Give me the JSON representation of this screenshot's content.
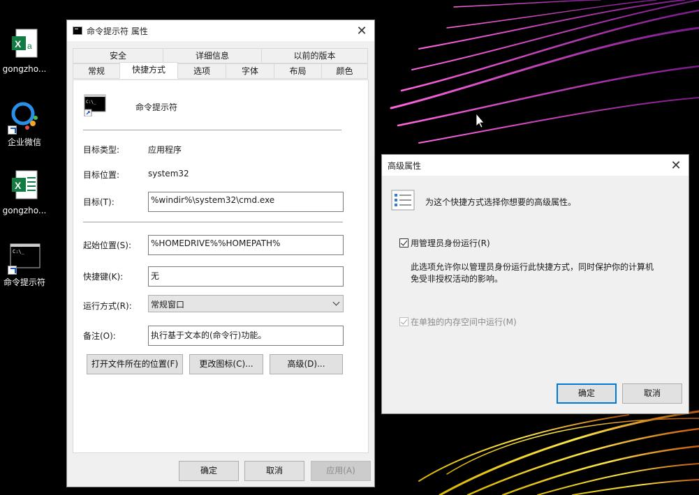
{
  "desktop": {
    "icons": [
      {
        "label": "gongzho...",
        "icon": "excel-icon"
      },
      {
        "label": "企业微信",
        "icon": "wecom-icon"
      },
      {
        "label": "gongzho...",
        "icon": "excel-icon"
      },
      {
        "label": "命令提示符",
        "icon": "cmd-icon"
      }
    ]
  },
  "props_window": {
    "title": "命令提示符 属性",
    "tabs_row1": [
      "安全",
      "详细信息",
      "以前的版本"
    ],
    "tabs_row2": [
      "常规",
      "快捷方式",
      "选项",
      "字体",
      "布局",
      "颜色"
    ],
    "active_tab": "快捷方式",
    "app_name": "命令提示符",
    "target_type_label": "目标类型:",
    "target_type_value": "应用程序",
    "target_location_label": "目标位置:",
    "target_location_value": "system32",
    "target_label": "目标(T):",
    "target_value": "%windir%\\system32\\cmd.exe",
    "start_in_label": "起始位置(S):",
    "start_in_value": "%HOMEDRIVE%%HOMEPATH%",
    "hotkey_label": "快捷键(K):",
    "hotkey_value": "无",
    "run_label": "运行方式(R):",
    "run_value": "常规窗口",
    "comment_label": "备注(O):",
    "comment_value": "执行基于文本的(命令行)功能。",
    "open_location_btn": "打开文件所在的位置(F)",
    "change_icon_btn": "更改图标(C)...",
    "advanced_btn": "高级(D)...",
    "ok_btn": "确定",
    "cancel_btn": "取消",
    "apply_btn": "应用(A)"
  },
  "adv_window": {
    "title": "高级属性",
    "description": "为这个快捷方式选择你想要的高级属性。",
    "run_as_admin_label": "用管理员身份运行(R)",
    "run_as_admin_checked": true,
    "admin_note_line1": "此选项允许你以管理员身份运行此快捷方式，同时保护你的计算机",
    "admin_note_line2": "免受非授权活动的影响。",
    "separate_memory_label": "在单独的内存空间中运行(M)",
    "separate_memory_checked": true,
    "ok_btn": "确定",
    "cancel_btn": "取消"
  }
}
